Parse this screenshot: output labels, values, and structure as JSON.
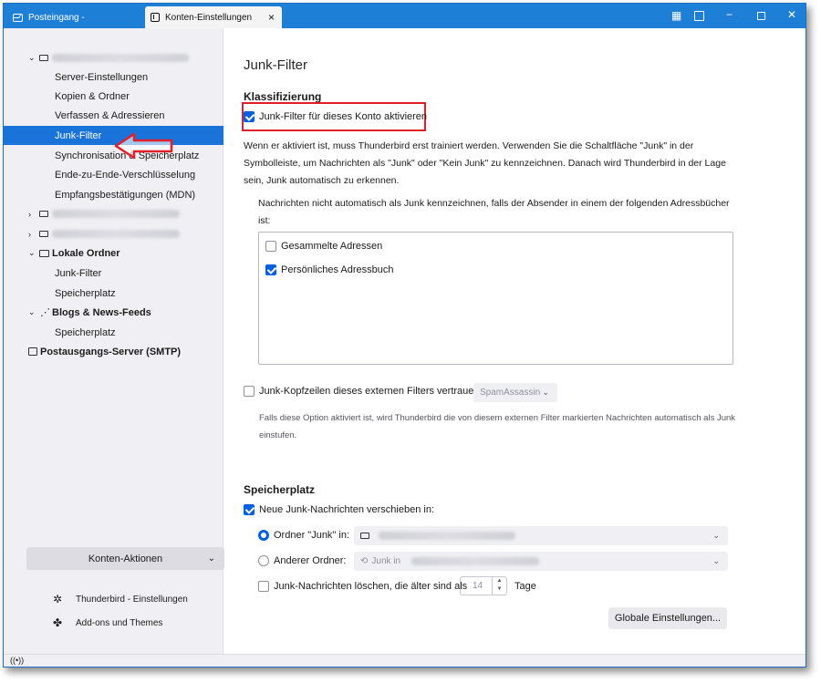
{
  "titlebar": {
    "tab_inactive_label": "Posteingang -",
    "tab_active_label": "Konten-Einstellungen",
    "tab_close": "×"
  },
  "sidebar": {
    "account1_items": [
      "Server-Einstellungen",
      "Kopien & Ordner",
      "Verfassen & Adressieren",
      "Junk-Filter",
      "Synchronisation & Speicherplatz",
      "Ende-zu-Ende-Verschlüsselung",
      "Empfangsbestätigungen (MDN)"
    ],
    "local_folders": "Lokale Ordner",
    "local_items": [
      "Junk-Filter",
      "Speicherplatz"
    ],
    "feeds": "Blogs & News-Feeds",
    "feeds_items": [
      "Speicherplatz"
    ],
    "smtp": "Postausgangs-Server (SMTP)",
    "konten_aktionen": "Konten-Aktionen",
    "tb_settings": "Thunderbird - Einstellungen",
    "addons": "Add-ons und Themes"
  },
  "content": {
    "title": "Junk-Filter",
    "classification_heading": "Klassifizierung",
    "activate_label": "Junk-Filter für dieses Konto aktivieren",
    "activate_checked": true,
    "description": "Wenn er aktiviert ist, muss Thunderbird erst trainiert werden. Verwenden Sie die Schaltfläche \"Junk\" in der Symbolleiste, um Nachrichten als \"Junk\" oder \"Kein Junk\" zu kennzeichnen. Danach wird Thunderbird in der Lage sein, Junk automatisch zu erkennen.",
    "whitelist_label": "Nachrichten nicht automatisch als Junk kennzeichnen, falls der Absender in einem der folgenden Adressbücher ist:",
    "addressbooks": [
      {
        "label": "Gesammelte Adressen",
        "checked": false
      },
      {
        "label": "Persönliches Adressbuch",
        "checked": true
      }
    ],
    "trust_headers_label": "Junk-Kopfzeilen dieses externen Filters vertrauen:",
    "trust_headers_checked": false,
    "filter_select": "SpamAssassin",
    "trust_note": "Falls diese Option aktiviert ist, wird Thunderbird die von diesem externen Filter markierten Nachrichten automatisch als Junk einstufen.",
    "storage_heading": "Speicherplatz",
    "move_label": "Neue Junk-Nachrichten verschieben in:",
    "move_checked": true,
    "folder_junk_label": "Ordner \"Junk\" in:",
    "other_folder_label": "Anderer Ordner:",
    "other_folder_value": "Junk in",
    "delete_label": "Junk-Nachrichten löschen, die älter sind als",
    "delete_days": "14",
    "days_label": "Tage",
    "global_button": "Globale Einstellungen..."
  }
}
